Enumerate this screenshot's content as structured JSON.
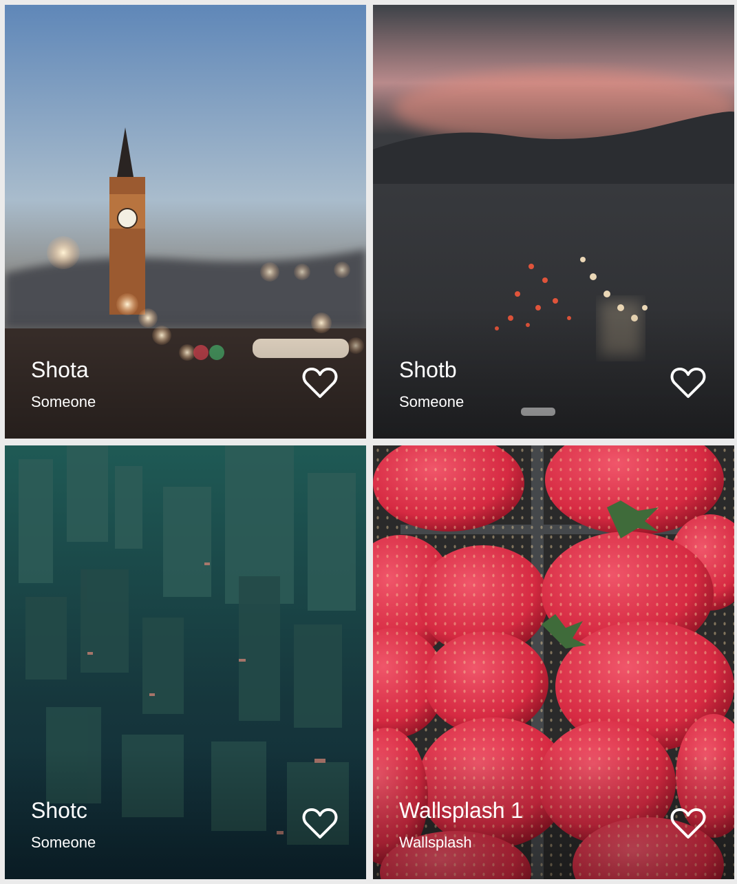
{
  "shots": [
    {
      "title": "Shota",
      "author": "Someone"
    },
    {
      "title": "Shotb",
      "author": "Someone"
    },
    {
      "title": "Shotc",
      "author": "Someone"
    },
    {
      "title": "Wallsplash 1",
      "author": "Wallsplash"
    }
  ],
  "icons": {
    "favorite": "heart-outline-icon"
  }
}
